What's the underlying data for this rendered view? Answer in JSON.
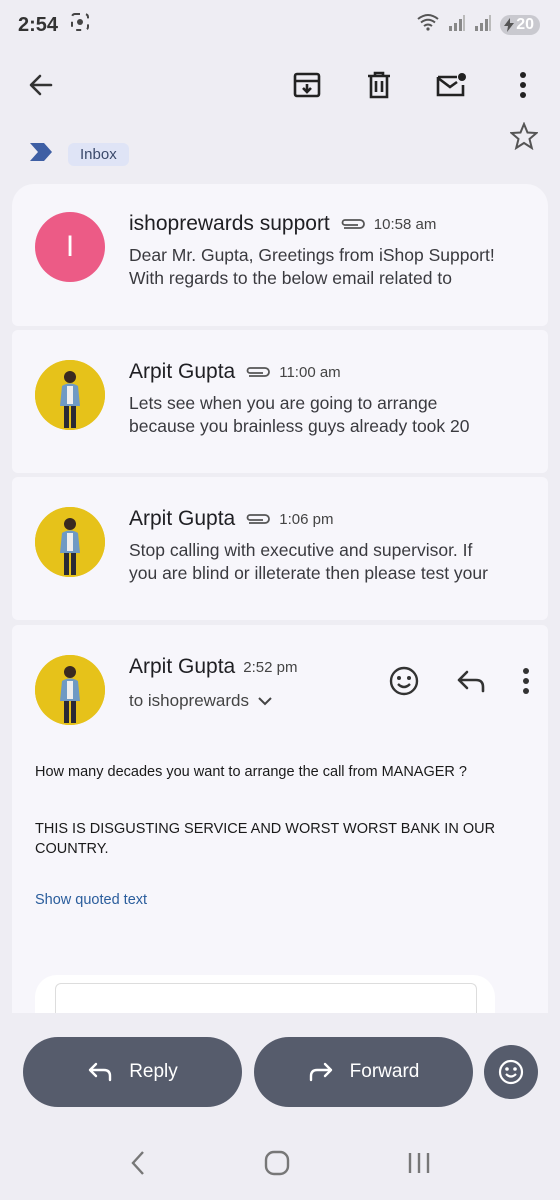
{
  "status": {
    "time": "2:54",
    "battery": "20"
  },
  "label": {
    "chip": "Inbox"
  },
  "messages": [
    {
      "avatar_letter": "I",
      "sender": "ishoprewards support",
      "time": "10:58 am",
      "snippet_line1": "Dear Mr. Gupta, Greetings from iShop Support!",
      "snippet_line2": "With regards to the below email related to"
    },
    {
      "sender": "Arpit Gupta",
      "time": "11:00 am",
      "snippet_line1": "Lets see when you are going to arrange",
      "snippet_line2": "because you brainless guys already took 20"
    },
    {
      "sender": "Arpit Gupta",
      "time": "1:06 pm",
      "snippet_line1": "Stop calling with executive and supervisor. If",
      "snippet_line2": "you are blind or illeterate then please test your"
    },
    {
      "sender": "Arpit Gupta",
      "time": "2:52 pm",
      "to": "to ishoprewards",
      "body_line1": "How many decades you want to arrange the call from MANAGER ?",
      "body_line2": "THIS IS DISGUSTING SERVICE AND WORST WORST BANK IN OUR",
      "body_line3": "COUNTRY.",
      "show_quoted": "Show quoted text"
    }
  ],
  "actions": {
    "reply": "Reply",
    "forward": "Forward"
  },
  "colors": {
    "avatar_pink": "#ec5b86",
    "pill": "#565c6c",
    "link": "#2a5d9c"
  }
}
